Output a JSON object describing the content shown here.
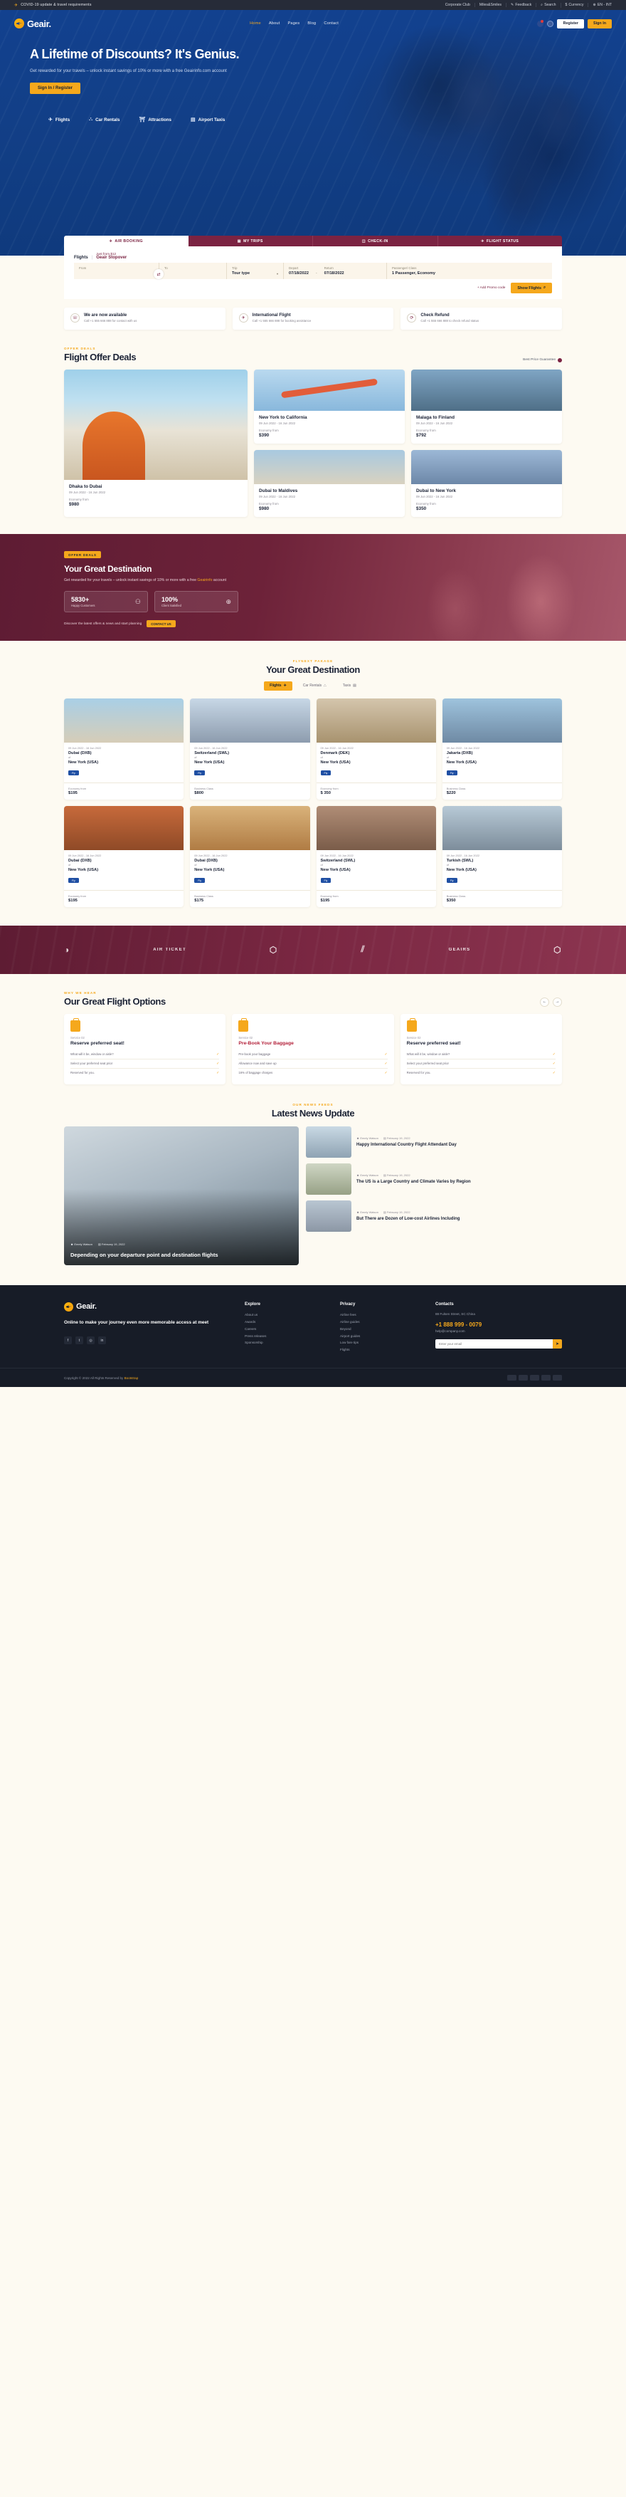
{
  "topbar": {
    "notice": "COVID-19 update & travel requirements",
    "links": [
      {
        "label": "Corporate Club",
        "icon": ""
      },
      {
        "label": "Miles&Smiles",
        "icon": ""
      },
      {
        "label": "Feedback",
        "icon": "chat-icon"
      },
      {
        "label": "Search",
        "icon": "search-icon"
      },
      {
        "label": "Currency",
        "icon": "dollar-icon"
      },
      {
        "label": "EN - INT",
        "icon": "globe-icon"
      }
    ]
  },
  "header": {
    "brand": "Geair.",
    "nav": [
      {
        "label": "Home",
        "active": true
      },
      {
        "label": "About",
        "active": false
      },
      {
        "label": "Pages",
        "active": false
      },
      {
        "label": "Blog",
        "active": false
      },
      {
        "label": "Contact",
        "active": false
      }
    ],
    "register_label": "Register",
    "signin_label": "Sign In"
  },
  "hero": {
    "title": "A Lifetime of Discounts? It's Genius.",
    "subtitle": "Get rewarded for your travels – unlock instant savings of 10% or more with a free Geairinfo.com account",
    "cta": "Sign In / Register",
    "categories": [
      {
        "label": "Flights",
        "icon": "plane-icon"
      },
      {
        "label": "Car Rentals",
        "icon": "car-icon"
      },
      {
        "label": "Attractions",
        "icon": "attractions-icon"
      },
      {
        "label": "Airport Taxis",
        "icon": "taxi-icon"
      }
    ]
  },
  "booking": {
    "tabs": [
      {
        "label": "AIR BOOKING",
        "icon": "plane-icon",
        "active": true
      },
      {
        "label": "MY TRIPS",
        "icon": "ticket-icon",
        "active": false
      },
      {
        "label": "CHECK-IN",
        "icon": "checkin-icon",
        "active": false
      },
      {
        "label": "FLIGHT STATUS",
        "icon": "status-icon",
        "active": false
      }
    ],
    "flights_label": "Flights",
    "divider": "|",
    "stopover_note": "Just from $12",
    "stopover_label": "Geair Stopover",
    "fields": {
      "from_label": "From",
      "from_value": "",
      "to_label": "To",
      "to_value": "",
      "trip_label": "Trip",
      "trip_value": "Tour type",
      "depart_label": "Depart",
      "depart_value": "07/18/2022",
      "return_label": "Return",
      "return_value": "07/18/2022",
      "pax_label": "Passenger/ Class",
      "pax_value": "1 Passenger, Economy"
    },
    "swap_icon": "swap-icon",
    "promo_label": "+ Add Promo code",
    "search_label": "Show Flights"
  },
  "features": [
    {
      "icon": "support-icon",
      "title": "We are now available",
      "desc": "Call +1 555 666 888 for contact with us"
    },
    {
      "icon": "plane-icon",
      "title": "International Flight",
      "desc": "Call +1 555 666 888 for booking assistance"
    },
    {
      "icon": "refund-icon",
      "title": "Check Refund",
      "desc": "Call +1 555 666 888 to check refund status"
    }
  ],
  "offers": {
    "eyebrow": "OFFER DEALS",
    "title": "Flight Offer Deals",
    "best_price": "Best Price Guarantee",
    "cards": [
      {
        "route": "Dhaka to Dubai",
        "date": "09 Jun 2022 - 16 Jun 2022",
        "class_label": "Economy from",
        "price": "$980",
        "photo": "ph-santorini"
      },
      {
        "route": "New York to California",
        "date": "09 Jun 2022 - 16 Jun 2022",
        "class_label": "Economy from",
        "price": "$390",
        "photo": "ph-plane"
      },
      {
        "route": "Malaga to Finland",
        "date": "09 Jun 2022 - 16 Jun 2022",
        "class_label": "Economy from",
        "price": "$792",
        "photo": "ph-malaga"
      },
      {
        "route": "Dubai to Maldives",
        "date": "09 Jun 2022 - 16 Jun 2022",
        "class_label": "Economy from",
        "price": "$980",
        "photo": "ph-dubai"
      },
      {
        "route": "Dubai to New York",
        "date": "09 Jun 2022 - 16 Jun 2022",
        "class_label": "Economy from",
        "price": "$350",
        "photo": "ph-ny"
      }
    ]
  },
  "destination_banner": {
    "tag": "OFFER DEALS",
    "title": "Your Great Destination",
    "desc_a": "Get rewarded for your travels – unlock instant savings of 10% or more with a free ",
    "desc_link": "Geairinfo",
    "desc_b": " account",
    "stats": [
      {
        "number": "5830+",
        "label": "Happy Customers",
        "icon": "people-icon"
      },
      {
        "number": "100%",
        "label": "Client Satisfied",
        "icon": "globe-icon"
      }
    ],
    "bottom_text": "Discover the latest offers & news and start planning",
    "bottom_cta": "CONTACT US"
  },
  "package": {
    "eyebrow": "FLYNEXT PAKAGE",
    "title": "Your Great Destination",
    "tabs": [
      {
        "label": "Flights",
        "icon": "plane-icon",
        "active": true
      },
      {
        "label": "Car Rentals",
        "icon": "car-icon",
        "active": false
      },
      {
        "label": "Taxis",
        "icon": "taxi-icon",
        "active": false
      }
    ],
    "cards": [
      {
        "date": "09 Jun 2022 - 16 Jun 2022",
        "from": "Dubai (DXB)",
        "of": "of",
        "to": "New York (USA)",
        "badge": "Fly",
        "class_label": "Economy from",
        "price": "$195",
        "photo": "ph-dest1"
      },
      {
        "date": "09 Jun 2022 - 16 Jun 2022",
        "from": "Switzerland (SWL)",
        "of": "of",
        "to": "New York (USA)",
        "badge": "Fly",
        "class_label": "Business Class",
        "price": "$800",
        "photo": "ph-dest2"
      },
      {
        "date": "09 Jun 2022 - 16 Jun 2022",
        "from": "Denmark (DEK)",
        "of": "of",
        "to": "New York (USA)",
        "badge": "Fly",
        "class_label": "Economy from",
        "price": "$ 350",
        "photo": "ph-dest3"
      },
      {
        "date": "09 Jun 2022 - 16 Jun 2022",
        "from": "Jakarta (DXB)",
        "of": "of",
        "to": "New York (USA)",
        "badge": "Fly",
        "class_label": "Business Class",
        "price": "$220",
        "photo": "ph-dest4"
      },
      {
        "date": "09 Jun 2022 - 16 Jun 2022",
        "from": "Dubai (DXB)",
        "of": "of",
        "to": "New York (USA)",
        "badge": "Fly",
        "class_label": "Economy from",
        "price": "$195",
        "photo": "ph-dest5"
      },
      {
        "date": "09 Jun 2022 - 16 Jun 2022",
        "from": "Dubai (DXB)",
        "of": "of",
        "to": "New York (USA)",
        "badge": "Fly",
        "class_label": "Business Class",
        "price": "$175",
        "photo": "ph-dest6"
      },
      {
        "date": "09 Jun 2022 - 16 Jun 2022",
        "from": "Switzerland (SWL)",
        "of": "of",
        "to": "New York (USA)",
        "badge": "Fly",
        "class_label": "Economy from",
        "price": "$195",
        "photo": "ph-dest7"
      },
      {
        "date": "09 Jun 2022 - 16 Jun 2022",
        "from": "Turkish (SWL)",
        "of": "of",
        "to": "New York (USA)",
        "badge": "Fly",
        "class_label": "Business Class",
        "price": "$350",
        "photo": "ph-dest8"
      }
    ]
  },
  "brandstrip": [
    {
      "label": "",
      "icon": "moon-icon"
    },
    {
      "label": "AIR TICKET",
      "icon": ""
    },
    {
      "label": "",
      "icon": "cube-icon"
    },
    {
      "label": "",
      "icon": "slash-icon"
    },
    {
      "label": "GEAIRS",
      "icon": ""
    },
    {
      "label": "",
      "icon": "cube-icon"
    }
  ],
  "options": {
    "eyebrow": "WHY WE HEAR",
    "title": "Our Great Flight Options",
    "prev_icon": "arrow-left-icon",
    "next_icon": "arrow-right-icon",
    "cards": [
      {
        "service": "Service 02",
        "title": "Reserve preferred seat!",
        "red": false,
        "items": [
          "What will it be, window or aisle?",
          "Select your preferred seat prior",
          "Reserved for you."
        ]
      },
      {
        "service": "Service 02",
        "title": "Pre-Book Your Baggage",
        "red": true,
        "items": [
          "Pre-book your baggage",
          "Allowance now and save up",
          "16% of baggage charges"
        ]
      },
      {
        "service": "Service 02",
        "title": "Reserve preferred seat!",
        "red": false,
        "items": [
          "What will it be, window or aisle?",
          "Select your preferred seat prior",
          "Reserved for you."
        ]
      }
    ]
  },
  "news": {
    "eyebrow": "OUR NEWS FEEDS",
    "title": "Latest News Update",
    "featured": {
      "author": "Emely Watson",
      "date": "February 19, 2022",
      "title": "Depending on your departure point and destination flights",
      "photo": "ph-hero-news"
    },
    "items": [
      {
        "author": "Emely Watson",
        "date": "February 19, 2022",
        "title": "Happy International Country Flight Attendant Day",
        "photo": "ph-news1"
      },
      {
        "author": "Emely Watson",
        "date": "February 19, 2022",
        "title": "The US is a Large Country and Climate Varies by Region",
        "photo": "ph-news2"
      },
      {
        "author": "Emely Watson",
        "date": "February 19, 2022",
        "title": "But There are Dozen of Low-cost Airlines Including",
        "photo": "ph-news3"
      }
    ]
  },
  "footer": {
    "brand": "Geair.",
    "tagline": "Online to make your journey even more memorable access at meet",
    "social": [
      {
        "icon": "facebook-icon"
      },
      {
        "icon": "twitter-icon"
      },
      {
        "icon": "instagram-icon"
      },
      {
        "icon": "linkedin-icon"
      }
    ],
    "columns": [
      {
        "heading": "Explore",
        "links": [
          "About us",
          "Awards",
          "Careers",
          "Press releases",
          "Sponsorship"
        ]
      },
      {
        "heading": "Privacy",
        "links": [
          "Airline fees",
          "Airline guides",
          "Beyond",
          "Airport guides",
          "Low fare tips",
          "Flights"
        ]
      }
    ],
    "contacts": {
      "heading": "Contacts",
      "address": "88 Fulsen Street, SC China",
      "email": "help@company.com",
      "phone": "+1 888 999 - 0079",
      "newsletter_placeholder": "Enter your email",
      "newsletter_icon": "send-icon"
    },
    "copyright_a": "Copyright © 2022 All Rights Reserved by ",
    "copyright_brand": "Bootstrap",
    "payments": [
      "visa",
      "mastercard",
      "amex",
      "paypal",
      "discover"
    ]
  }
}
